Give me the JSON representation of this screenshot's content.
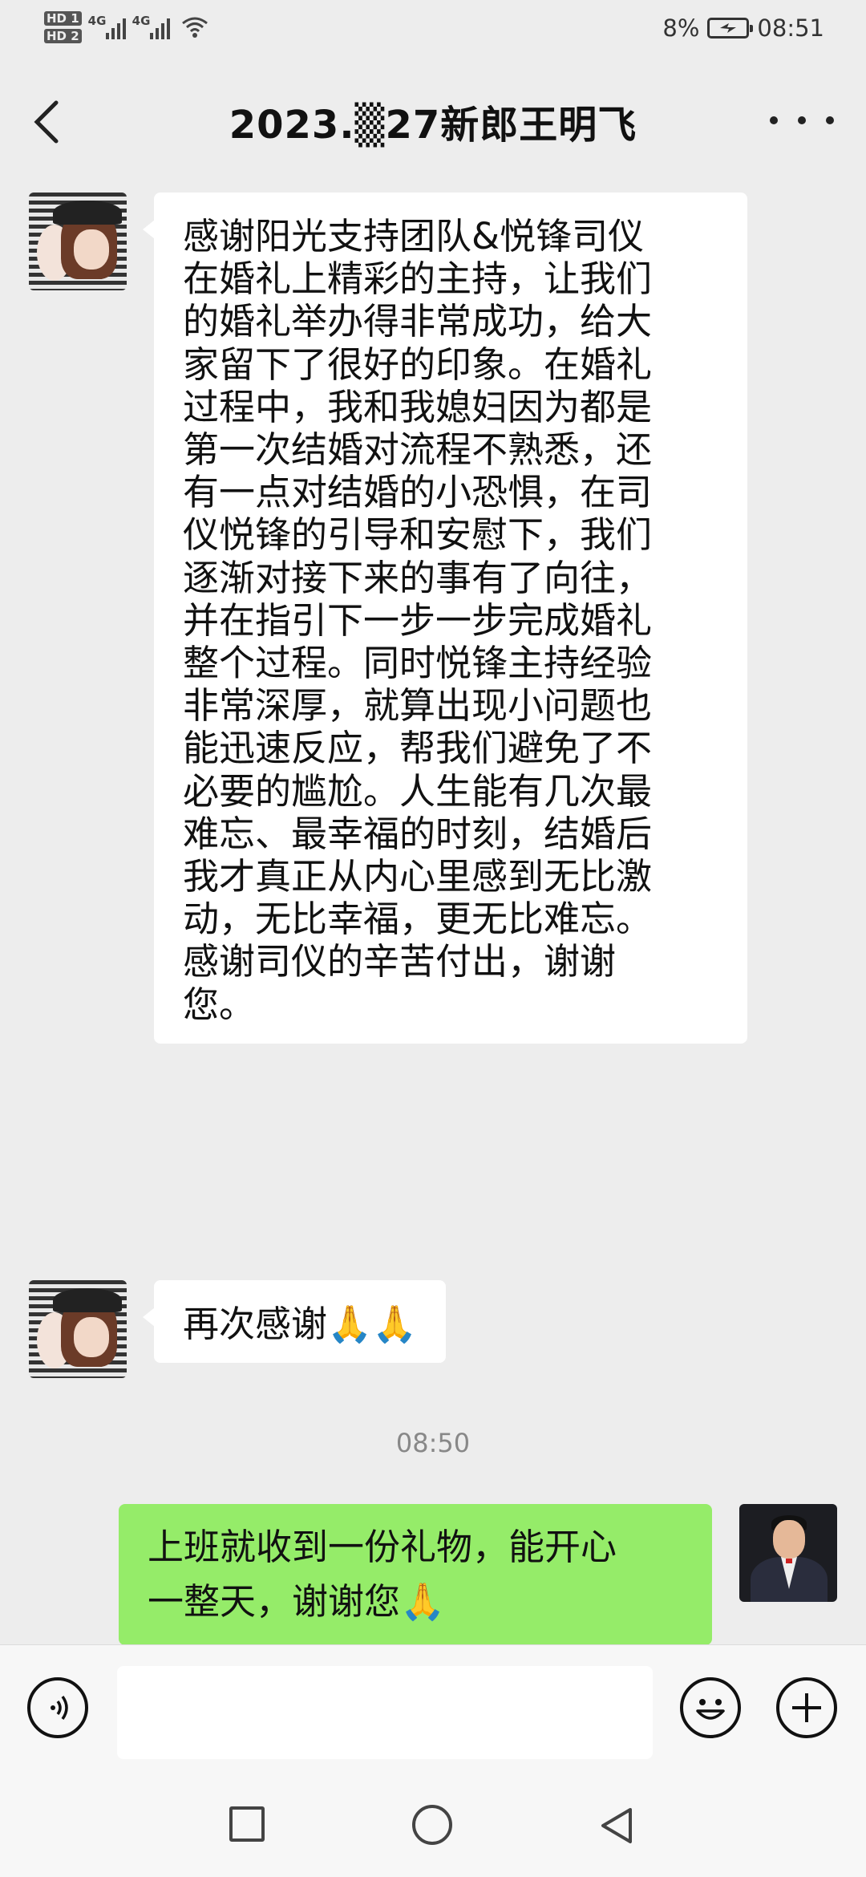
{
  "status_bar": {
    "left_badges": [
      "HD 1",
      "HD 2"
    ],
    "network_1": "4G",
    "network_2": "4G",
    "battery_percent": "8%",
    "time": "08:51",
    "icons": [
      "signal-icon",
      "wifi-icon",
      "battery-charging-icon"
    ]
  },
  "header": {
    "title": "2023.▒27新郎王明飞",
    "back_icon": "chevron-left-icon",
    "more_icon": "more-dots-icon"
  },
  "messages": [
    {
      "direction": "incoming",
      "lines": [
        "感谢阳光支持团队&悦锋司仪",
        "在婚礼上精彩的主持，让我们",
        "的婚礼举办得非常成功，给大",
        "家留下了很好的印象。在婚礼",
        "过程中，我和我媳妇因为都是",
        "第一次结婚对流程不熟悉，还",
        "有一点对结婚的小恐惧，在司",
        "仪悦锋的引导和安慰下，我们",
        "逐渐对接下来的事有了向往，",
        "并在指引下一步一步完成婚礼",
        "整个过程。同时悦锋主持经验",
        "非常深厚，就算出现小问题也",
        "能迅速反应，帮我们避免了不",
        "必要的尴尬。人生能有几次最",
        "难忘、最幸福的时刻，结婚后",
        "我才真正从内心里感到无比激",
        "动，无比幸福，更无比难忘。",
        "感谢司仪的辛苦付出，谢谢",
        "您。"
      ]
    },
    {
      "direction": "incoming",
      "text": "再次感谢🙏🙏"
    },
    {
      "timestamp": "08:50"
    },
    {
      "direction": "outgoing",
      "lines": [
        "上班就收到一份礼物，能开心",
        "一整天，谢谢您🙏"
      ]
    }
  ],
  "input_bar": {
    "voice_icon": "voice-icon",
    "input_value": "",
    "emoji_icon": "emoji-icon",
    "add_icon": "plus-icon"
  },
  "nav_bar": {
    "icons": [
      "recent-apps-icon",
      "home-icon",
      "back-icon"
    ]
  },
  "colors": {
    "background": "#ededed",
    "incoming_bubble": "#ffffff",
    "outgoing_bubble": "#95ec69",
    "text": "#111111",
    "timestamp": "#888888"
  }
}
